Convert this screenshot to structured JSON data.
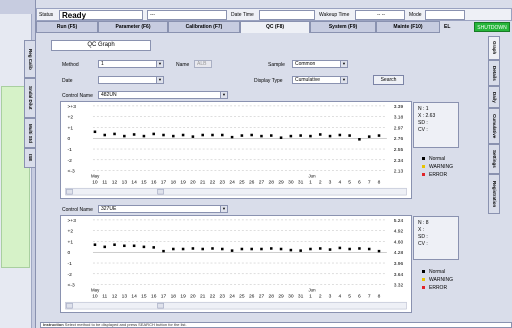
{
  "header": {
    "status_label": "Status",
    "status_value": "Ready",
    "field1": "---",
    "datetime_label": "Date Time",
    "wakeup_label": "Wakeup Time",
    "wakeup_value": "-- --",
    "mode_label": "Mode",
    "el_label": "EL",
    "shutdown_label": "SHUTDOWN"
  },
  "tabs": [
    "Run (F5)",
    "Parameter (F6)",
    "Calibration (F7)",
    "QC (F8)",
    "System (F9)",
    "Mainte (F10)"
  ],
  "left_tabs": [
    "Reg Calib",
    "Sndal Dilut",
    "Multi Std",
    "ISE"
  ],
  "right_tabs": [
    "Graph",
    "Details",
    "Daily",
    "Cumulative",
    "Settings",
    "Registration"
  ],
  "qc": {
    "title": "QC Graph",
    "method_label": "Method",
    "method_value": "1",
    "name_label": "Name",
    "name_value": "ALB",
    "sample_label": "Sample",
    "sample_value": "Common",
    "date_label": "Date",
    "display_type_label": "Display Type",
    "display_type_value": "Cumulative",
    "search_label": "Search",
    "control_name_label": "Control Name"
  },
  "charts": [
    {
      "control_name": "482UN",
      "ylabels": [
        ">+3",
        "+2",
        "+1",
        "0",
        "-1",
        "-2",
        "<-3"
      ],
      "right_values": [
        "3.39",
        "3.18",
        "2.97",
        "2.76",
        "2.55",
        "2.34",
        "2.13"
      ],
      "month_label_1": "May",
      "month_label_2": "Jun",
      "x_ticks": [
        "10",
        "11",
        "12",
        "13",
        "14",
        "15",
        "16",
        "17",
        "18",
        "19",
        "20",
        "21",
        "22",
        "23",
        "24",
        "25",
        "26",
        "27",
        "28",
        "29",
        "30",
        "31",
        "1",
        "2",
        "3",
        "4",
        "5",
        "6",
        "7",
        "8"
      ],
      "stats": {
        "n": "N : 1",
        "x": "X : 2.63",
        "sd": "SD :",
        "cv": "CV :"
      },
      "points_sd": [
        0.6,
        0.3,
        0.4,
        0.2,
        0.35,
        0.2,
        0.4,
        0.3,
        0.2,
        0.3,
        0.15,
        0.3,
        0.3,
        0.3,
        0.1,
        0.25,
        0.3,
        0.2,
        0.25,
        0.05,
        0.2,
        0.25,
        0.2,
        0.35,
        0.2,
        0.3,
        0.25,
        -0.1,
        0.15,
        0.25
      ]
    },
    {
      "control_name": "327UE",
      "ylabels": [
        ">+3",
        "+2",
        "+1",
        "0",
        "-1",
        "-2",
        "<-3"
      ],
      "right_values": [
        "5.24",
        "4.92",
        "4.60",
        "4.28",
        "3.96",
        "3.64",
        "3.32"
      ],
      "month_label_1": "May",
      "month_label_2": "Jun",
      "x_ticks": [
        "10",
        "11",
        "12",
        "13",
        "14",
        "15",
        "16",
        "17",
        "18",
        "19",
        "20",
        "21",
        "22",
        "23",
        "24",
        "25",
        "26",
        "27",
        "28",
        "29",
        "30",
        "31",
        "1",
        "2",
        "3",
        "4",
        "5",
        "6",
        "7",
        "8"
      ],
      "stats": {
        "n": "N : 8",
        "x": "X :",
        "sd": "SD :",
        "cv": "CV :"
      },
      "points_sd": [
        0.7,
        0.5,
        0.7,
        0.6,
        0.6,
        0.5,
        0.45,
        0.1,
        0.3,
        0.3,
        0.35,
        0.3,
        0.35,
        0.3,
        0.15,
        0.3,
        0.3,
        0.3,
        0.35,
        0.3,
        0.2,
        0.15,
        0.3,
        0.35,
        0.25,
        0.4,
        0.3,
        0.35,
        0.3,
        0.1
      ]
    }
  ],
  "legend": [
    {
      "label": "Normal",
      "color": "#000000"
    },
    {
      "label": "WARNING",
      "color": "#e8c400"
    },
    {
      "label": "ERROR",
      "color": "#e0242a"
    }
  ],
  "instruction": {
    "label": "Instruction",
    "text": "Select method to be displayed and press SEARCH button for the list."
  }
}
